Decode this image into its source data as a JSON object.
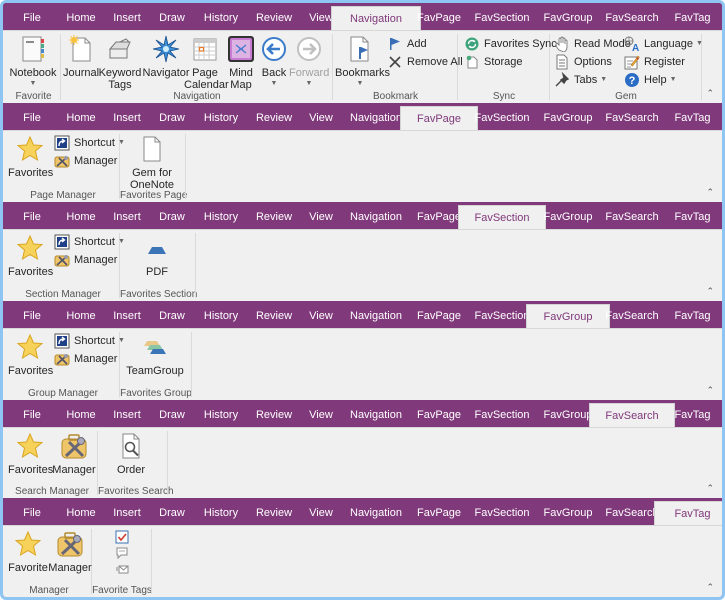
{
  "tabs": [
    "File",
    "Home",
    "Insert",
    "Draw",
    "History",
    "Review",
    "View",
    "Navigation",
    "FavPage",
    "FavSection",
    "FavGroup",
    "FavSearch",
    "FavTag"
  ],
  "colors": {
    "ribbon_purple": "#80397b",
    "ribbon_body": "#f0f0f0",
    "window_border": "#8ec5f2",
    "active_tab_text": "#80397b"
  },
  "ribbons": {
    "navigation": {
      "active_tab": "Navigation",
      "groups": {
        "favorite": {
          "label": "Favorite",
          "notebook": {
            "label": "Notebook",
            "icon": "notebook-icon",
            "has_dropdown": true
          }
        },
        "navigation": {
          "label": "Navigation",
          "journal": {
            "label": "Journal",
            "icon": "journal-icon"
          },
          "keyword_tags": {
            "label1": "Keyword",
            "label2": "Tags",
            "icon": "keyword-tags-icon"
          },
          "navigator": {
            "label": "Navigator",
            "icon": "navigator-star-icon"
          },
          "page_calendar": {
            "label1": "Page",
            "label2": "Calendar",
            "icon": "calendar-icon"
          },
          "mind_map": {
            "label1": "Mind",
            "label2": "Map",
            "icon": "mind-map-icon"
          },
          "back": {
            "label": "Back",
            "icon": "back-arrow-icon",
            "has_dropdown": true
          },
          "forward": {
            "label": "Forward",
            "icon": "forward-arrow-icon",
            "has_dropdown": true,
            "disabled": true
          }
        },
        "bookmark": {
          "label": "Bookmark",
          "bookmarks": {
            "label": "Bookmarks",
            "icon": "bookmarks-icon",
            "has_dropdown": true
          },
          "add": {
            "label": "Add",
            "icon": "flag-icon"
          },
          "remove_all": {
            "label": "Remove All",
            "icon": "x-icon"
          }
        },
        "sync": {
          "label": "Sync",
          "favorites_sync": {
            "label": "Favorites Sync",
            "icon": "sync-icon"
          },
          "storage": {
            "label": "Storage",
            "icon": "storage-icon"
          }
        },
        "gem": {
          "label": "Gem",
          "read_mode": {
            "label": "Read Mode",
            "icon": "hand-icon"
          },
          "options": {
            "label": "Options",
            "icon": "options-icon"
          },
          "tabs": {
            "label": "Tabs",
            "icon": "pin-icon",
            "has_dropdown": true
          },
          "language": {
            "label": "Language",
            "icon": "language-icon",
            "has_dropdown": true
          },
          "register": {
            "label": "Register",
            "icon": "register-icon"
          },
          "help": {
            "label": "Help",
            "icon": "help-icon",
            "has_dropdown": true
          }
        }
      }
    },
    "favpage": {
      "active_tab": "FavPage",
      "manager_group": {
        "label": "Page Manager",
        "favorites": "Favorites",
        "shortcut": "Shortcut",
        "manager": "Manager"
      },
      "fav_group": {
        "label": "Favorites Page",
        "item1": "Gem for",
        "item2": "OneNote"
      }
    },
    "favsection": {
      "active_tab": "FavSection",
      "manager_group": {
        "label": "Section Manager",
        "favorites": "Favorites",
        "shortcut": "Shortcut",
        "manager": "Manager"
      },
      "fav_group": {
        "label": "Favorites Section",
        "item": "PDF"
      }
    },
    "favgroup": {
      "active_tab": "FavGroup",
      "manager_group": {
        "label": "Group Manager",
        "favorites": "Favorites",
        "shortcut": "Shortcut",
        "manager": "Manager"
      },
      "fav_group": {
        "label": "Favorites Group",
        "item": "TeamGroup"
      }
    },
    "favsearch": {
      "active_tab": "FavSearch",
      "manager_group": {
        "label": "Search Manager",
        "favorites": "Favorites",
        "manager": "Manager"
      },
      "fav_group": {
        "label": "Favorites Search",
        "item": "Order"
      }
    },
    "favtag": {
      "active_tab": "FavTag",
      "manager_group": {
        "label": "Manager",
        "favorite": "Favorite",
        "manager": "Manager"
      },
      "fav_group": {
        "label": "Favorite Tags",
        "tags": [
          "to-do-checkbox-icon",
          "speech-bubble-icon",
          "email-tag-icon"
        ]
      }
    }
  }
}
